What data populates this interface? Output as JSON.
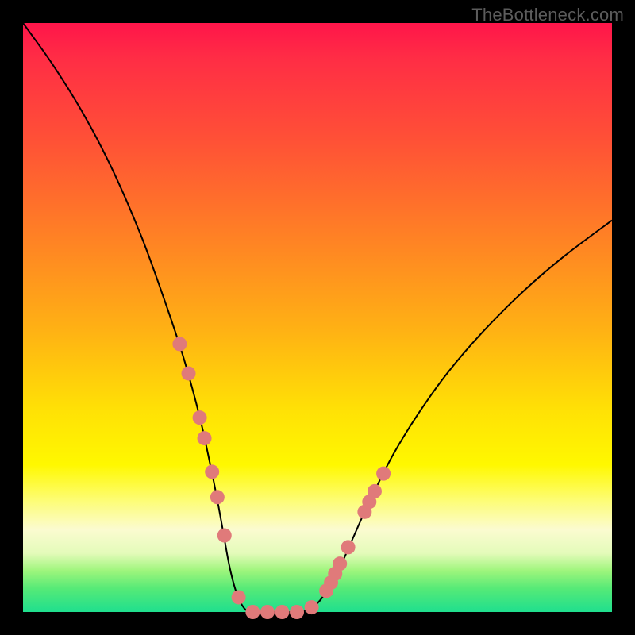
{
  "watermark": "TheBottleneck.com",
  "colors": {
    "frame": "#000000",
    "curve": "#000000",
    "marker": "#e07a7a",
    "gradient_top": "#ff154a",
    "gradient_bottom": "#1fdf8e"
  },
  "chart_data": {
    "type": "line",
    "title": "",
    "xlabel": "",
    "ylabel": "",
    "xlim": [
      0,
      100
    ],
    "ylim": [
      0,
      100
    ],
    "series": [
      {
        "name": "bottleneck-curve",
        "x": [
          0,
          5,
          10,
          15,
          20,
          24,
          27,
          29,
          30.5,
          32,
          33,
          34,
          35,
          36,
          37,
          38,
          39,
          40.5,
          42,
          44,
          46,
          48,
          50,
          52,
          54,
          56,
          58,
          60,
          63,
          67,
          72,
          78,
          85,
          92,
          100
        ],
        "y": [
          100,
          93,
          85,
          75.5,
          64,
          53,
          44,
          37,
          31,
          24,
          19,
          13.5,
          8,
          4,
          1.5,
          0.2,
          0,
          0,
          0,
          0,
          0,
          0.2,
          1.5,
          4.2,
          8,
          12.5,
          17,
          21.2,
          27,
          33.5,
          40.5,
          47.5,
          54.5,
          60.5,
          66.5
        ]
      }
    ],
    "markers": {
      "name": "highlight-points",
      "x": [
        26.6,
        28.1,
        30.0,
        30.8,
        32.1,
        33.0,
        34.2,
        36.6,
        39.0,
        41.5,
        44.0,
        46.5,
        49.0,
        51.5,
        52.3,
        53.0,
        53.8,
        55.2,
        58.0,
        58.8,
        59.7,
        61.2
      ],
      "y": [
        45.5,
        40.5,
        33.0,
        29.5,
        23.8,
        19.5,
        13.0,
        2.5,
        0.0,
        0.0,
        0.0,
        0.0,
        0.8,
        3.6,
        5.0,
        6.5,
        8.2,
        11.0,
        17.0,
        18.7,
        20.5,
        23.5
      ]
    }
  }
}
